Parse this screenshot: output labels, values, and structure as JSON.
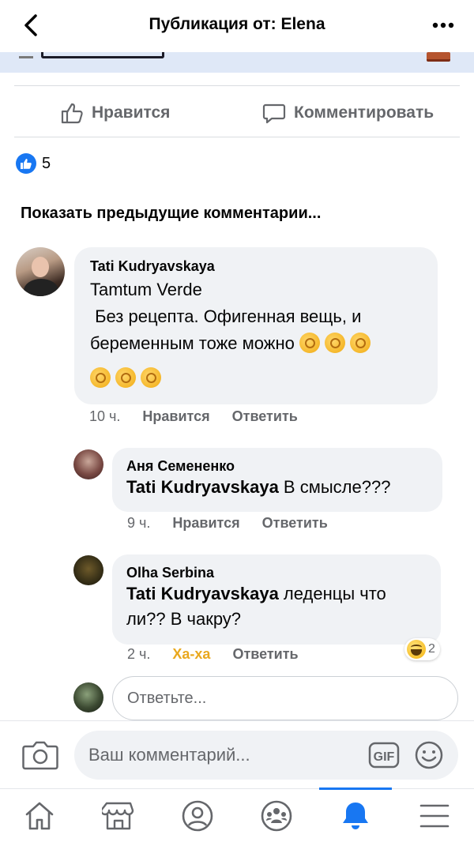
{
  "header": {
    "title": "Публикация от: Elena",
    "back_icon": "chevron-left-icon",
    "more_icon": "ellipsis-icon"
  },
  "actions": {
    "like_label": "Нравится",
    "comment_label": "Комментировать"
  },
  "reactions": {
    "count": "5"
  },
  "previous_comments_label": "Показать предыдущие комментарии...",
  "comments": [
    {
      "author": "Tati Kudryavskaya",
      "line1": "Tamtum Verde",
      "line2": " Без рецепта. Офигенная вещь, и",
      "line3": "беременным тоже можно",
      "emoji": "ok-hand-emoji",
      "time": "10 ч.",
      "like_label": "Нравится",
      "reply_label": "Ответить"
    },
    {
      "author": "Аня Семененко",
      "mention": "Tati Kudryavskaya",
      "text": " В смысле???",
      "time": "9 ч.",
      "like_label": "Нравится",
      "reply_label": "Ответить"
    },
    {
      "author": "Olha Serbina",
      "mention": "Tati Kudryavskaya",
      "text_line1": " леденцы что",
      "text_line2": "ли?? В чакру?",
      "time": "2 ч.",
      "reaction_label": "Ха-ха",
      "reply_label": "Ответить",
      "reaction_count": "2"
    }
  ],
  "reply_placeholder": "Ответьте...",
  "composer": {
    "placeholder": "Ваш комментарий...",
    "gif_label": "GIF"
  },
  "colors": {
    "accent": "#1877f2",
    "bubble": "#f0f2f5",
    "muted": "#65676b",
    "haha": "#e9a81e"
  },
  "bottom_nav": [
    "home-icon",
    "marketplace-icon",
    "profile-icon",
    "groups-icon",
    "notifications-icon",
    "menu-icon"
  ]
}
